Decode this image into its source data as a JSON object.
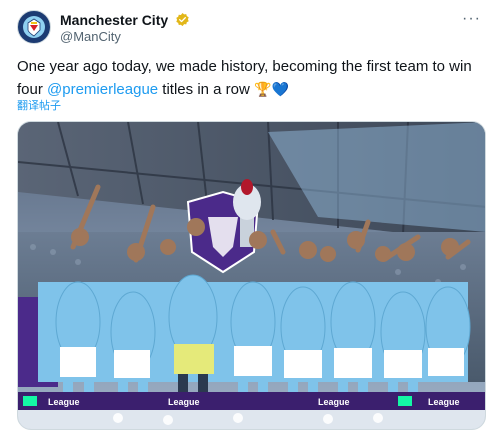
{
  "author": {
    "display_name": "Manchester City",
    "handle": "@ManCity",
    "avatar_icon": "mancity-crest-icon",
    "verified_icon": "gold-verified-badge-icon",
    "more_icon": "more-dots-icon"
  },
  "tweet": {
    "text_before": "One year ago today, we made history, becoming the first team to win four ",
    "mention": "@premierleague",
    "text_after": " titles in a row ",
    "emojis": [
      "🏆",
      "💙"
    ],
    "translate_label": "翻译帖子"
  },
  "media": {
    "description_icon": "team-celebration-photo",
    "board_text": "League",
    "colors": {
      "sky_blue": "#7fc3ea",
      "stand_dark": "#3a4a5e",
      "purple": "#4b2a8a"
    }
  }
}
